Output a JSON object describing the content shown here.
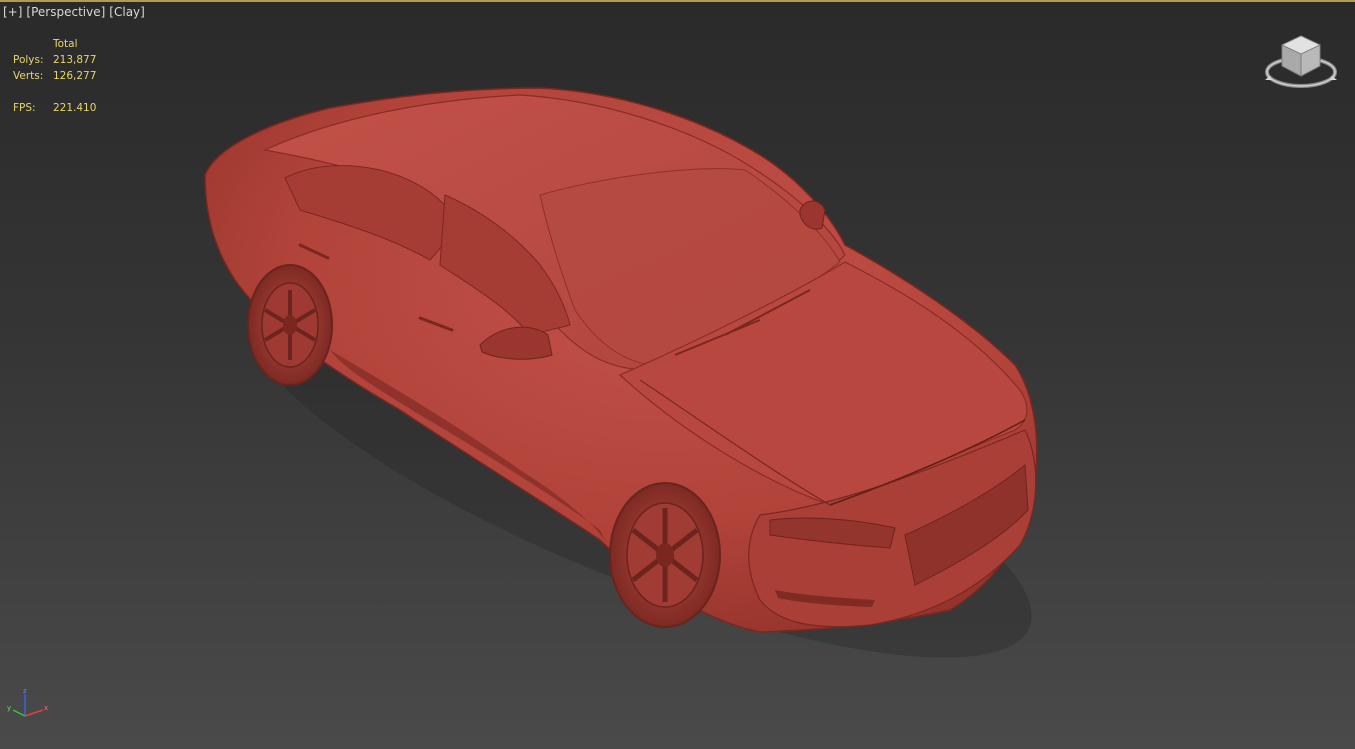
{
  "viewport": {
    "labels": [
      "[+]",
      "[Perspective]",
      "[Clay]"
    ]
  },
  "stats": {
    "header": "Total",
    "polys_label": "Polys:",
    "polys_value": "213,877",
    "verts_label": "Verts:",
    "verts_value": "126,277",
    "fps_label": "FPS:",
    "fps_value": "221.410"
  },
  "colors": {
    "clay": "#b5433a",
    "background_top": "#2a2a2a",
    "background_bottom": "#4a4a4a",
    "stats_text": "#e7d76b",
    "active_border": "#b79a4f"
  },
  "icons": {
    "viewcube": "viewcube-icon",
    "axis": "axis-tripod-icon"
  }
}
